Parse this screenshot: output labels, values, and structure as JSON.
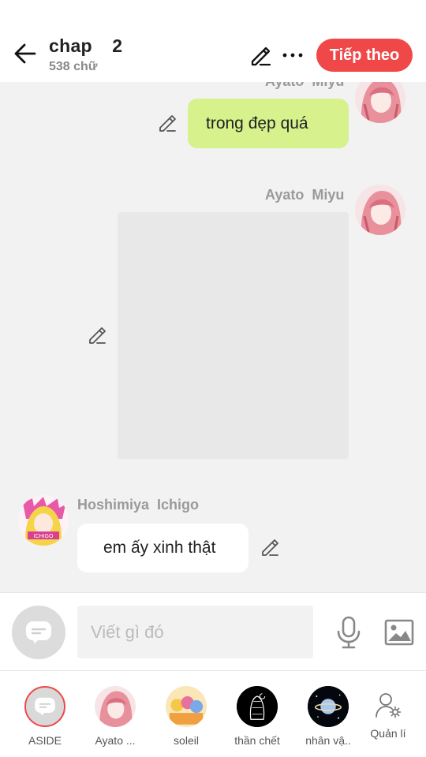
{
  "header": {
    "title": "chap  2",
    "word_count": "538 chữ",
    "next_button": "Tiếp theo"
  },
  "messages": [
    {
      "sender": "Ayato  Miyu",
      "text": "trong đẹp quá",
      "side": "right"
    },
    {
      "sender": "Ayato  Miyu",
      "type": "image",
      "side": "right"
    },
    {
      "sender": "Hoshimiya Ichigo",
      "text": "em ấy xinh thật",
      "side": "left"
    }
  ],
  "composer": {
    "placeholder": "Viết gì đó"
  },
  "characters": [
    {
      "label": "ASIDE",
      "icon": "chat-bubble-icon"
    },
    {
      "label": "Ayato ...",
      "icon": "avatar-pink-hair"
    },
    {
      "label": "soleil",
      "icon": "avatar-group"
    },
    {
      "label": "thần chết",
      "icon": "avatar-dark"
    },
    {
      "label": "nhân vậ..",
      "icon": "avatar-planet"
    },
    {
      "label": "Quản lí",
      "icon": "user-settings-icon"
    }
  ],
  "colors": {
    "accent": "#f04848",
    "bubble_green": "#d7f18d",
    "chat_bg": "#f2f2f2"
  }
}
